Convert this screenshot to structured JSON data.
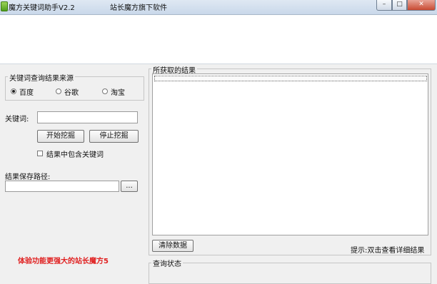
{
  "window": {
    "title": "魔方关键词助手V2.2",
    "subtitle": "站长魔方旗下软件",
    "minimize_glyph": "–",
    "maximize_glyph": "□",
    "close_glyph": "✕"
  },
  "source_group": {
    "legend": "关键词查询结果来源",
    "options": [
      "百度",
      "谷歌",
      "淘宝"
    ],
    "selected": "百度"
  },
  "keyword": {
    "label": "关键词:",
    "value": ""
  },
  "buttons": {
    "start": "开始挖掘",
    "stop": "停止挖掘",
    "browse": "...",
    "clear": "清除数据"
  },
  "include_keyword": {
    "label": "结果中包含关键词",
    "checked": false
  },
  "save_path": {
    "label": "结果保存路径:",
    "value": ""
  },
  "promo": "体验功能更强大的站长魔方5",
  "results": {
    "legend": "所获取的结果",
    "hint": "提示:双击查看详细结果"
  },
  "status": {
    "legend": "查询状态"
  }
}
